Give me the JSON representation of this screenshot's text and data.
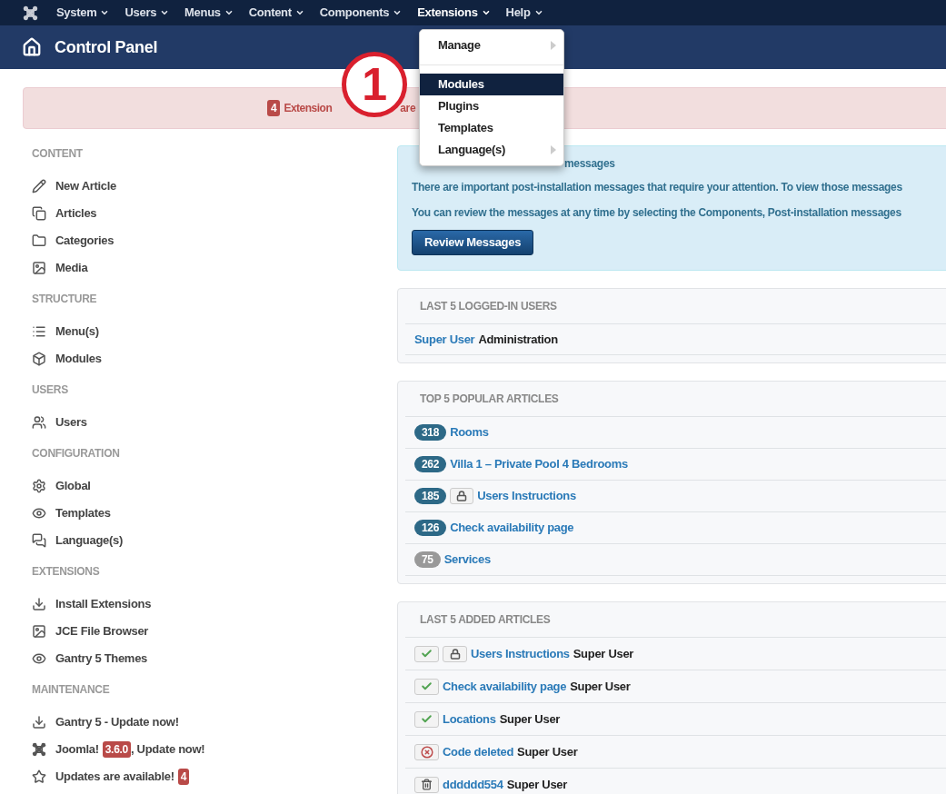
{
  "nav": {
    "items": [
      {
        "label": "System",
        "selected": false
      },
      {
        "label": "Users",
        "selected": false
      },
      {
        "label": "Menus",
        "selected": false
      },
      {
        "label": "Content",
        "selected": false
      },
      {
        "label": "Components",
        "selected": false
      },
      {
        "label": "Extensions",
        "selected": true
      },
      {
        "label": "Help",
        "selected": false
      }
    ]
  },
  "dropdown": {
    "items": [
      {
        "kind": "item",
        "label": "Manage",
        "submenu": true,
        "selected": false
      },
      {
        "kind": "divider"
      },
      {
        "kind": "item",
        "label": "Modules",
        "submenu": false,
        "selected": true
      },
      {
        "kind": "item",
        "label": "Plugins",
        "submenu": false,
        "selected": false
      },
      {
        "kind": "item",
        "label": "Templates",
        "submenu": false,
        "selected": false
      },
      {
        "kind": "item",
        "label": "Language(s)",
        "submenu": true,
        "selected": false
      }
    ]
  },
  "header": {
    "title": "Control Panel"
  },
  "annotation": {
    "label": "1"
  },
  "alert": {
    "count": "4",
    "parts": [
      "Extension",
      "are"
    ]
  },
  "sidebar": {
    "sections": [
      {
        "heading": "CONTENT",
        "items": [
          {
            "kind": "pencil",
            "label": "New Article"
          },
          {
            "kind": "copy",
            "label": "Articles"
          },
          {
            "kind": "folder",
            "label": "Categories"
          },
          {
            "kind": "image",
            "label": "Media"
          }
        ]
      },
      {
        "heading": "STRUCTURE",
        "items": [
          {
            "kind": "list",
            "label": "Menu(s)"
          },
          {
            "kind": "cube",
            "label": "Modules"
          }
        ]
      },
      {
        "heading": "USERS",
        "items": [
          {
            "kind": "users",
            "label": "Users"
          }
        ]
      },
      {
        "heading": "CONFIGURATION",
        "items": [
          {
            "kind": "gear",
            "label": "Global"
          },
          {
            "kind": "eye",
            "label": "Templates"
          },
          {
            "kind": "chat",
            "label": "Language(s)"
          }
        ]
      },
      {
        "heading": "EXTENSIONS",
        "items": [
          {
            "kind": "download",
            "label": "Install Extensions"
          },
          {
            "kind": "image",
            "label": "JCE File Browser"
          },
          {
            "kind": "eye",
            "label": "Gantry 5 Themes"
          }
        ]
      },
      {
        "heading": "MAINTENANCE",
        "items": [
          {
            "kind": "download",
            "label": "Gantry 5 - Update now!"
          },
          {
            "kind": "joomla",
            "label": "Joomla!",
            "badge": "3.6.0",
            "suffix": ", Update now!"
          },
          {
            "kind": "star",
            "label": "Updates are available!",
            "badge": "4"
          }
        ]
      }
    ]
  },
  "postinstall": {
    "title": "messages",
    "lines": [
      "There are important post-installation messages that require your attention. To view those messages",
      "You can review the messages at any time by selecting the Components, Post-installation messages"
    ],
    "button": "Review Messages"
  },
  "logged_in": {
    "title": "LAST 5 LOGGED-IN USERS",
    "rows": [
      {
        "name": "Super User",
        "client": "Administration"
      }
    ]
  },
  "popular": {
    "title": "TOP 5 POPULAR ARTICLES",
    "rows": [
      {
        "hits": "318",
        "color": "#2d6987",
        "locked": false,
        "title": "Rooms"
      },
      {
        "hits": "262",
        "color": "#2d6987",
        "locked": false,
        "title": "Villa 1 – Private Pool 4 Bedrooms"
      },
      {
        "hits": "185",
        "color": "#2d6987",
        "locked": true,
        "title": "Users Instructions"
      },
      {
        "hits": "126",
        "color": "#2d6987",
        "locked": false,
        "title": "Check availability page"
      },
      {
        "hits": "75",
        "color": "#999999",
        "locked": false,
        "title": "Services"
      }
    ]
  },
  "latest": {
    "title": "LAST 5 ADDED ARTICLES",
    "rows": [
      {
        "kind": "published",
        "locked": true,
        "title": "Users Instructions",
        "author": "Super User"
      },
      {
        "kind": "published",
        "locked": false,
        "title": "Check availability page",
        "author": "Super User"
      },
      {
        "kind": "published",
        "locked": false,
        "title": "Locations",
        "author": "Super User"
      },
      {
        "kind": "unpublished",
        "locked": false,
        "title": "Code deleted",
        "author": "Super User"
      },
      {
        "kind": "trashed",
        "locked": false,
        "title": "dddddd554",
        "author": "Super User"
      }
    ]
  }
}
